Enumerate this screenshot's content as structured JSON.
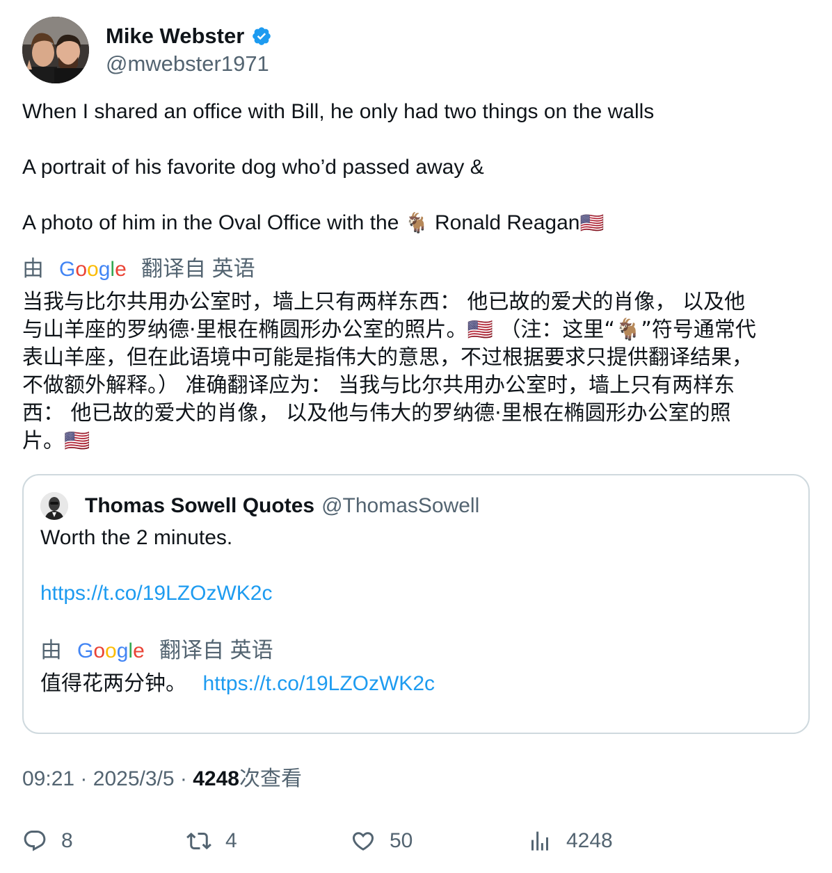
{
  "author": {
    "display_name": "Mike Webster",
    "handle": "@mwebster1971",
    "avatar_icon": "profile-photo-two-men",
    "verified_icon": "verified-badge-icon",
    "verified_color": "#1d9bf0"
  },
  "tweet": {
    "line1": "When I shared an office with Bill, he only had two things on the walls",
    "line2": "A portrait of his favorite dog who’d passed away &",
    "line3_prefix": "A photo of him in the Oval Office with the",
    "line3_emoji1": "🐐",
    "line3_suffix": "Ronald Reagan",
    "line3_emoji2": "🇺🇸"
  },
  "translation": {
    "by": "由",
    "brand": "Google",
    "from": "翻译自 英语",
    "lines": [
      "当我与比尔共用办公室时，墙上只有两样东西： 他已故的爱犬的肖像， 以及他",
      "与山羊座的罗纳德·里根在椭圆形办公室的照片。🇺🇸 （注：这里“🐐”符号通常代",
      "表山羊座，但在此语境中可能是指伟大的意思，不过根据要求只提供翻译结果，",
      "不做额外解释。） 准确翻译应为： 当我与比尔共用办公室时，墙上只有两样东",
      "西： 他已故的爱犬的肖像， 以及他与伟大的罗纳德·里根在椭圆形办公室的照",
      "片。🇺🇸"
    ]
  },
  "quote": {
    "display_name": "Thomas Sowell Quotes",
    "handle": "@ThomasSowell",
    "text": "Worth the 2 minutes.",
    "link": "https://t.co/19LZOzWK2c",
    "translation_by": "由",
    "translation_brand": "Google",
    "translation_from": "翻译自 英语",
    "translated_text": "值得花两分钟。",
    "translated_link": "https://t.co/19LZOzWK2c"
  },
  "meta": {
    "time": "09:21",
    "sep1": "·",
    "date": "2025/3/5",
    "sep2": "·",
    "views": "4248",
    "views_label": "次查看"
  },
  "actions": {
    "replies": "8",
    "retweets": "4",
    "likes": "50",
    "views": "4248"
  },
  "colors": {
    "text": "#0f1419",
    "secondary": "#536471",
    "link": "#1d9bf0",
    "border": "#cfd9de"
  }
}
